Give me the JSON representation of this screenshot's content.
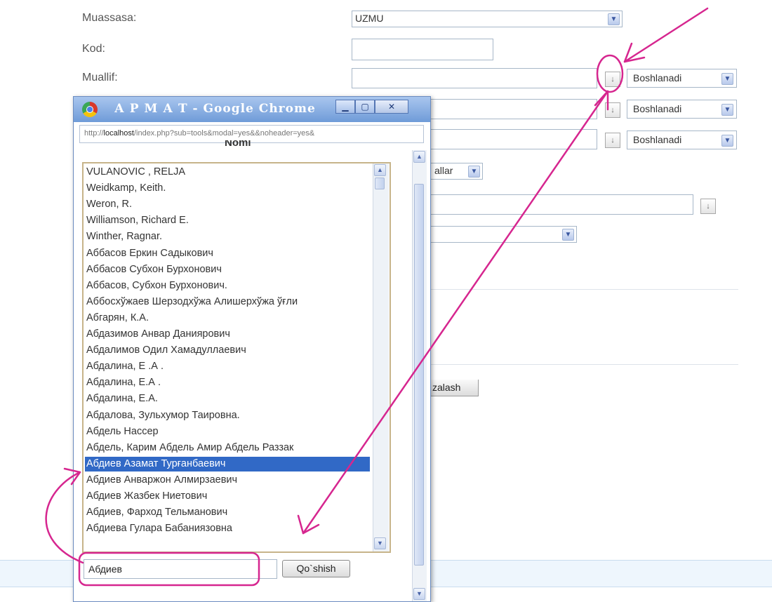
{
  "form": {
    "muassasa_label": "Muassasa:",
    "muassasa_value": "UZMU",
    "kod_label": "Kod:",
    "muallif_label": "Muallif:",
    "match_option": "Boshlanadi",
    "pick_glyph": "↓",
    "partial_select": "allar",
    "partial_button": "zalash"
  },
  "popup": {
    "title": "А Р М А Т - Google Chrome",
    "url_prefix": "http://",
    "url_host": "localhost",
    "url_rest": "/index.php?sub=tools&modal=yes&&noheader=yes&",
    "heading": "Nomi",
    "list": [
      "VULANOVIC , RELJA",
      "Weidkamp, Keith.",
      "Weron, R.",
      "Williamson, Richard E.",
      "Winther, Ragnar.",
      "Аббасов Еркин Садыкович",
      "Аббасов Субхон Бурхонович",
      "Аббасов, Субхон Бурхонович.",
      "Аббосхўжаев Шерзодхўжа Алишерхўжа ўғли",
      "Абгарян, К.А.",
      "Абдазимов Анвар Даниярович",
      "Абдалимов Одил Хамадуллаевич",
      "Абдалина, Е .А .",
      "Абдалина, Е.А .",
      "Абдалина, Е.А.",
      "Абдалова, Зульхумор Таировна.",
      "Абдель Нассер",
      "Абдель, Карим Абдель Амир Абдель Раззак",
      "Абдиев Азамат Турғанбаевич",
      "Абдиев Анваржон Алмирзаевич",
      "Абдиев Жазбек Ниетович",
      "Абдиев, Фарход Тельманович",
      "Абдиева Гулара Бабаниязовна"
    ],
    "selected_index": 18,
    "search_value": "Абдиев",
    "search_button": "Qo`shish"
  },
  "colors": {
    "annotation": "#d6268f",
    "selection": "#3169c6"
  }
}
